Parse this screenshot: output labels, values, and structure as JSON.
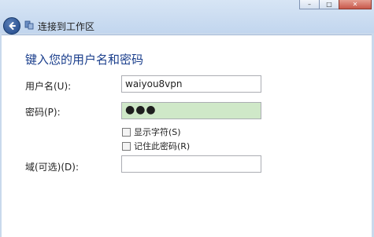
{
  "window": {
    "title": "连接到工作区",
    "controls": {
      "minimize": "–",
      "maximize": "□",
      "close": "✕"
    }
  },
  "heading": "键入您的用户名和密码",
  "form": {
    "username_label": "用户名(U):",
    "username_value": "waiyou8vpn",
    "password_label": "密码(P):",
    "password_value": "●●●",
    "show_chars_label": "显示字符(S)",
    "remember_password_label": "记住此密码(R)",
    "domain_label": "域(可选)(D):",
    "domain_value": ""
  },
  "colors": {
    "heading": "#1a3e8c",
    "password_bg": "#cfe8c8",
    "chrome": "#c9d9ec"
  }
}
